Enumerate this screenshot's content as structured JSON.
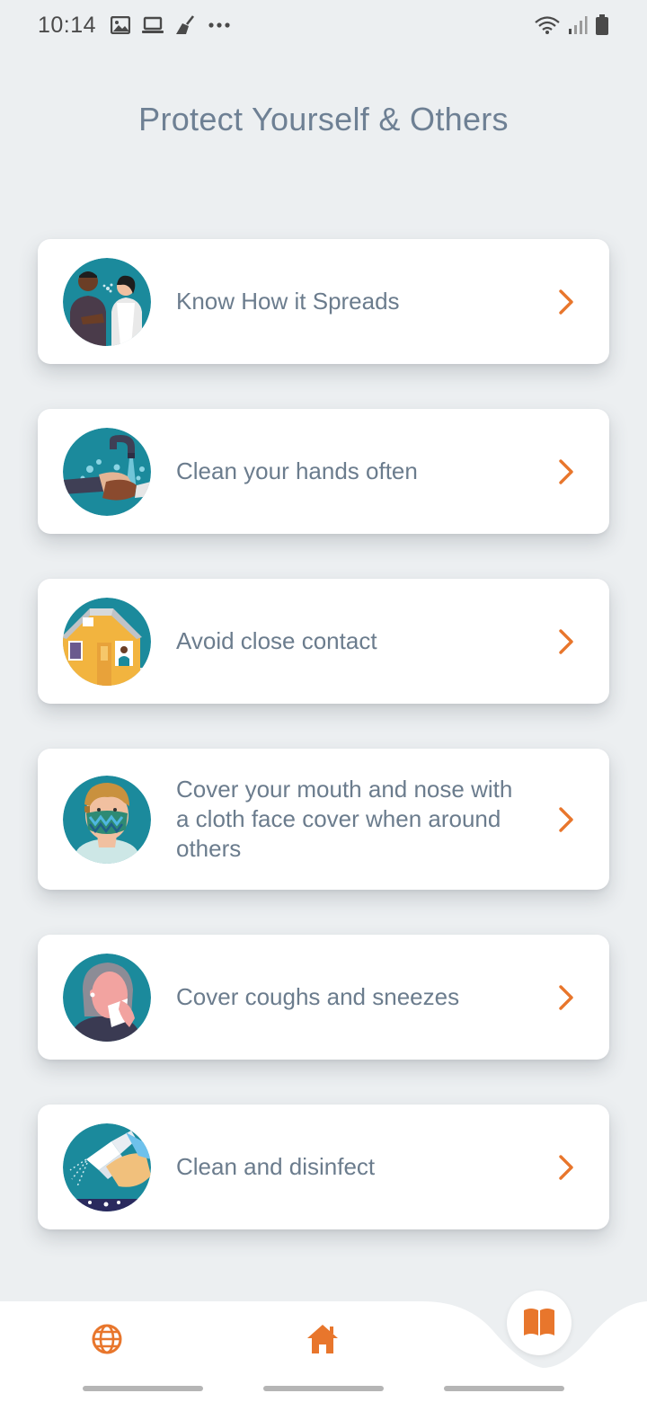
{
  "status_bar": {
    "time": "10:14",
    "left_icons": [
      "image-icon",
      "laptop-icon",
      "broom-icon",
      "more-dots-icon"
    ],
    "right_icons": [
      "wifi-icon",
      "signal-icon",
      "battery-icon"
    ]
  },
  "page": {
    "title": "Protect Yourself & Others"
  },
  "cards": [
    {
      "label": "Know How it Spreads",
      "icon": "people-talking-icon"
    },
    {
      "label": "Clean your hands often",
      "icon": "handwashing-icon"
    },
    {
      "label": "Avoid close contact",
      "icon": "house-icon"
    },
    {
      "label": "Cover your mouth and nose with a cloth face cover when around others",
      "icon": "face-mask-icon"
    },
    {
      "label": "Cover coughs and sneezes",
      "icon": "tissue-sneeze-icon"
    },
    {
      "label": "Clean and disinfect",
      "icon": "spray-disinfect-icon"
    }
  ],
  "bottom_nav": {
    "items": [
      "globe-icon",
      "home-icon",
      "book-icon"
    ],
    "active": "book-icon"
  },
  "colors": {
    "accent": "#E8762C",
    "teal": "#1B8A9C",
    "background": "#ECEFF1",
    "text": "#6B7C8D"
  }
}
